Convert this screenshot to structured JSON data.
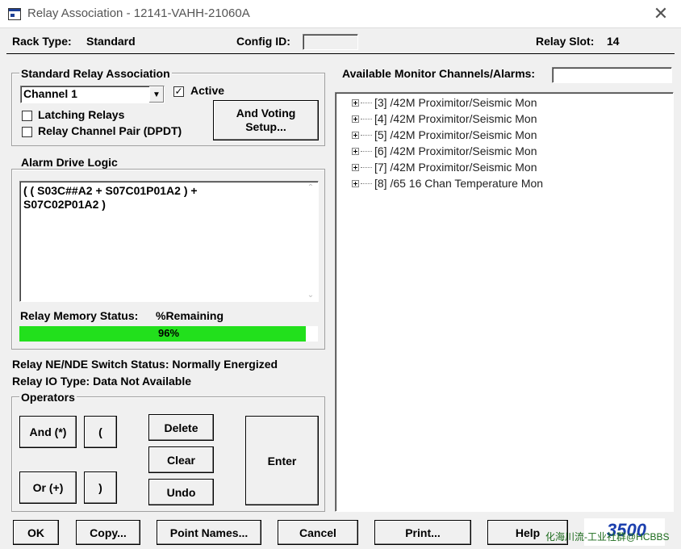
{
  "window": {
    "title": "Relay Association - 12141-VAHH-21060A"
  },
  "header": {
    "rack_type_label": "Rack Type:",
    "rack_type_value": "Standard",
    "config_id_label": "Config ID:",
    "config_id_value": "",
    "relay_slot_label": "Relay Slot:",
    "relay_slot_value": "14"
  },
  "relay_assoc": {
    "group_label": "Standard Relay Association",
    "channel_value": "Channel 1",
    "active_label": "Active",
    "active_checked": true,
    "latching_label": "Latching Relays",
    "latching_checked": false,
    "dpdt_label": "Relay Channel Pair (DPDT)",
    "dpdt_checked": false,
    "and_voting_line1": "And Voting",
    "and_voting_line2": "Setup..."
  },
  "alarm_logic": {
    "group_label": "Alarm Drive Logic",
    "expression": "( ( S03C##A2 + S07C01P01A2 ) +\nS07C02P01A2 )",
    "memory_label": "Relay Memory Status:",
    "remaining_label": "%Remaining",
    "memory_percent": 96,
    "memory_text": "96%"
  },
  "status": {
    "switch_status": "Relay NE/NDE Switch Status: Normally Energized",
    "io_type": "Relay IO Type: Data Not Available"
  },
  "operators": {
    "group_label": "Operators",
    "and_label": "And (*)",
    "or_label": "Or (+)",
    "open_paren": "(",
    "close_paren": ")",
    "delete_label": "Delete",
    "clear_label": "Clear",
    "undo_label": "Undo",
    "enter_label": "Enter"
  },
  "monitor": {
    "label": "Available Monitor Channels/Alarms:",
    "search_value": "",
    "tree_items": [
      "[3] /42M Proximitor/Seismic Mon",
      "[4] /42M Proximitor/Seismic Mon",
      "[5] /42M Proximitor/Seismic Mon",
      "[6] /42M Proximitor/Seismic Mon",
      "[7] /42M Proximitor/Seismic Mon",
      "[8] /65 16 Chan Temperature Mon"
    ]
  },
  "footer": {
    "ok_label": "OK",
    "copy_label": "Copy...",
    "point_names_label": "Point Names...",
    "cancel_label": "Cancel",
    "print_label": "Print...",
    "help_label": "Help",
    "logo_text": "3500",
    "watermark": "化海川流-工业社群@HCBBS"
  },
  "colors": {
    "progress": "#22e01c",
    "logo": "#1b3fae",
    "title_icon": "#1c3f95"
  }
}
